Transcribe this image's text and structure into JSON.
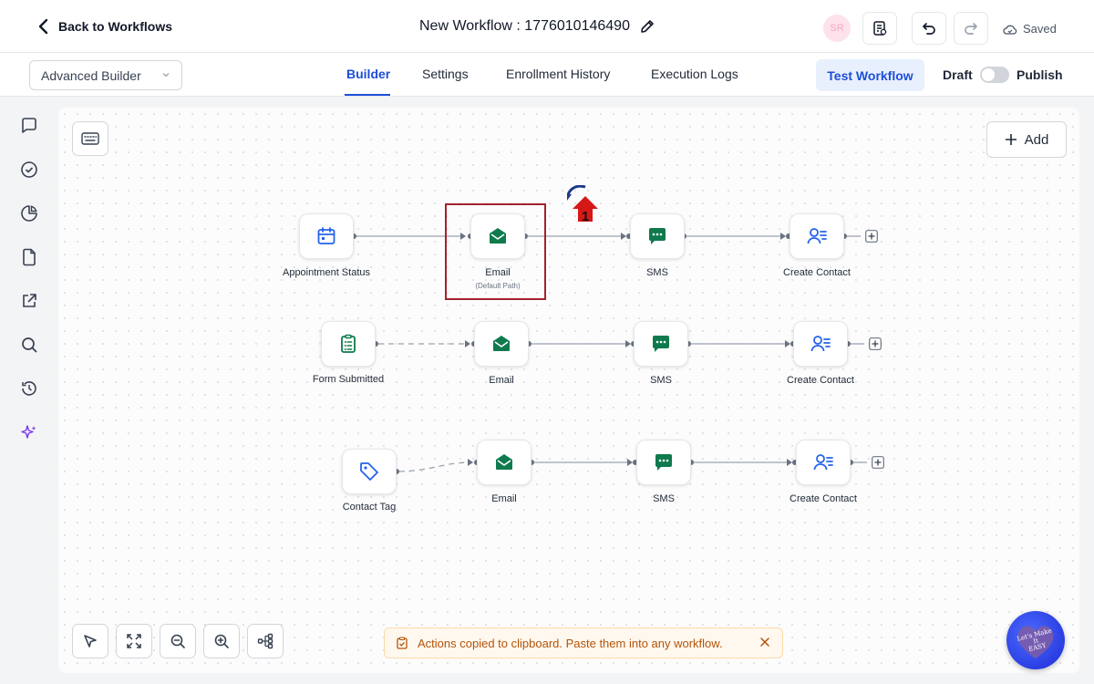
{
  "header": {
    "back_label": "Back to Workflows",
    "workflow_title": "New Workflow : 1776010146490",
    "avatar_initials": "SR",
    "saved_label": "Saved"
  },
  "subheader": {
    "builder_mode": "Advanced Builder",
    "tabs": [
      {
        "label": "Builder",
        "active": true
      },
      {
        "label": "Settings",
        "active": false
      },
      {
        "label": "Enrollment History",
        "active": false
      },
      {
        "label": "Execution Logs",
        "active": false
      }
    ],
    "test_button": "Test Workflow",
    "draft_label": "Draft",
    "publish_label": "Publish",
    "publish_enabled": false
  },
  "sidebar": {
    "icons": [
      "chat-icon",
      "check-circle-icon",
      "pie-chart-icon",
      "document-icon",
      "external-link-icon",
      "search-icon",
      "history-icon",
      "sparkle-icon"
    ]
  },
  "canvas": {
    "add_button": "Add",
    "rows": [
      {
        "trigger": {
          "label": "Appointment Status",
          "icon": "calendar-icon"
        },
        "actions": [
          {
            "label": "Email",
            "sublabel": "(Default Path)",
            "icon": "email-icon"
          },
          {
            "label": "SMS",
            "icon": "sms-icon"
          },
          {
            "label": "Create Contact",
            "icon": "contact-icon"
          }
        ]
      },
      {
        "trigger": {
          "label": "Form Submitted",
          "icon": "clipboard-icon"
        },
        "actions": [
          {
            "label": "Email",
            "icon": "email-icon"
          },
          {
            "label": "SMS",
            "icon": "sms-icon"
          },
          {
            "label": "Create Contact",
            "icon": "contact-icon"
          }
        ]
      },
      {
        "trigger": {
          "label": "Contact Tag",
          "icon": "tag-icon"
        },
        "actions": [
          {
            "label": "Email",
            "icon": "email-icon"
          },
          {
            "label": "SMS",
            "icon": "sms-icon"
          },
          {
            "label": "Create Contact",
            "icon": "contact-icon"
          }
        ]
      }
    ],
    "annotation_number": "1",
    "toast_message": "Actions copied to clipboard. Paste them into any workflow.",
    "bottom_tools": [
      "pointer-icon",
      "fit-view-icon",
      "zoom-out-icon",
      "zoom-in-icon",
      "auto-layout-icon"
    ]
  },
  "watermark": {
    "text": "Let's Make It EASY"
  },
  "colors": {
    "accent": "#1d4ed8",
    "action_icon": "#0f7a4d",
    "trigger_icon": "#2563eb",
    "highlight_box": "#a3232b",
    "marker_red": "#d61818",
    "toast_text": "#b45309"
  }
}
